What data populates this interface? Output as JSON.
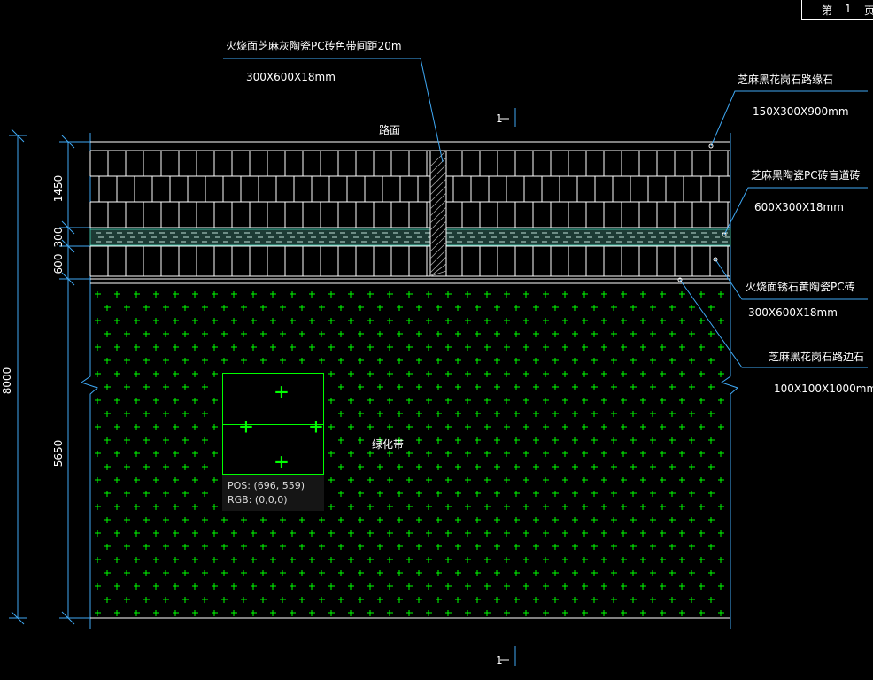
{
  "page_box": {
    "prefix": "第",
    "number": "1",
    "suffix": "页"
  },
  "labels": {
    "road_surface": "路面",
    "green_belt": "绿化带",
    "tile_band_title": "火烧面芝麻灰陶瓷PC砖色带间距20m",
    "tile_band_size": "300X600X18mm",
    "curb_top_title": "芝麻黑花岗石路缘石",
    "curb_top_size": "150X300X900mm",
    "blind_tile_title": "芝麻黑陶瓷PC砖盲道砖",
    "blind_tile_size": "600X300X18mm",
    "yellow_tile_title": "火烧面锈石黄陶瓷PC砖",
    "yellow_tile_size": "300X600X18mm",
    "edge_stone_title": "芝麻黑花岗石路边石",
    "edge_stone_size": "100X100X1000mm",
    "section_mark": "1"
  },
  "dimensions": {
    "d1450": "1450",
    "d300": "300",
    "d600": "600",
    "d5650": "5650",
    "d8000": "8000"
  },
  "colors": {
    "lines": "#ffffff",
    "leaders": "#3fa9f5",
    "grass": "#00ff00",
    "blind_band": "#3fb9a0"
  },
  "pixel_info": {
    "pos_label": "POS:",
    "pos_value": "(696, 559)",
    "rgb_label": "RGB:",
    "rgb_value": "(0,0,0)"
  }
}
